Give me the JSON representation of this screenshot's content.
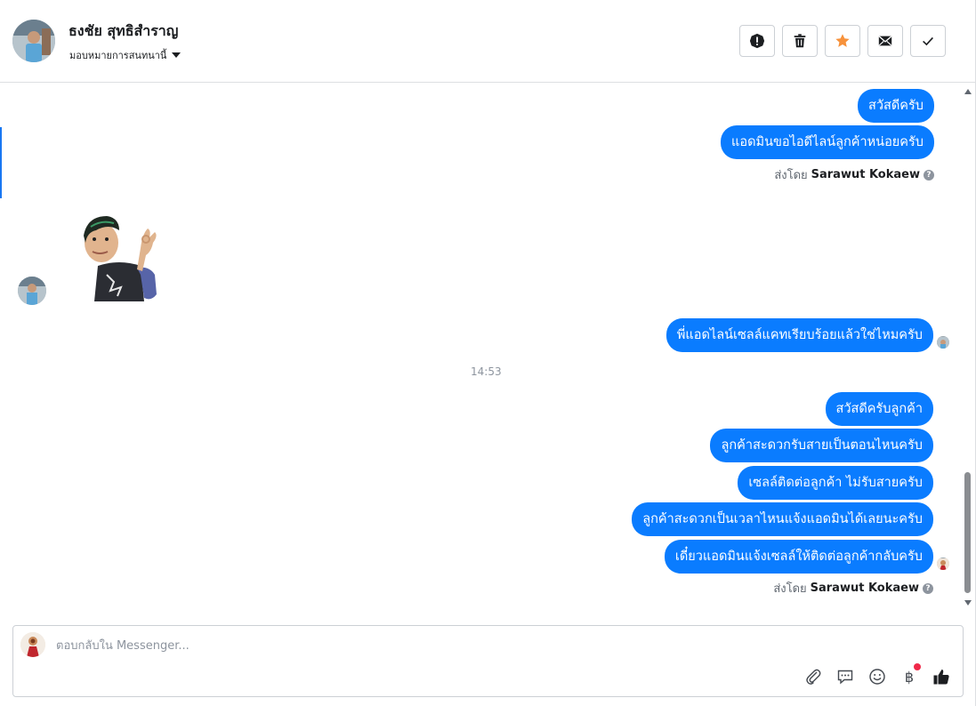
{
  "header": {
    "contact_name": "ธงชัย สุทธิสำราญ",
    "assign_label": "มอบหมายการสนทนานี้",
    "actions": [
      {
        "name": "spam-button",
        "icon": "alert-icon"
      },
      {
        "name": "delete-button",
        "icon": "trash-icon"
      },
      {
        "name": "star-button",
        "icon": "star-icon"
      },
      {
        "name": "mark-unread-button",
        "icon": "envelope-icon"
      },
      {
        "name": "mark-done-button",
        "icon": "check-icon"
      }
    ]
  },
  "messages": {
    "group1": [
      "สวัสดีครับ",
      "แอดมินขอไอดีไลน์ลูกค้าหน่อยครับ"
    ],
    "sent_by_prefix": "ส่งโดย",
    "sent_by_name": "Sarawut Kokaew",
    "incoming_sticker": "sticker-waving-ok",
    "reply": "พี่แอดไลน์เซลล์แคทเรียบร้อยแล้วใช่ไหมครับ",
    "time": "14:53",
    "group2": [
      "สวัสดีครับลูกค้า",
      "ลูกค้าสะดวกรับสายเป็นตอนไหนครับ",
      "เซลล์ติดต่อลูกค้า ไม่รับสายครับ",
      "ลูกค้าสะดวกเป็นเวลาไหนแจ้งแอดมินได้เลยนะครับ",
      "เดี๋ยวแอดมินแจ้งเซลล์ให้ติดต่อลูกค้ากลับครับ"
    ],
    "sent_by_prefix_2": "ส่งโดย",
    "sent_by_name_2": "Sarawut Kokaew"
  },
  "composer": {
    "placeholder": "ตอบกลับใน Messenger..."
  },
  "colors": {
    "bubble": "#0a7cff",
    "star": "#f7923b",
    "badge": "#f02849"
  }
}
